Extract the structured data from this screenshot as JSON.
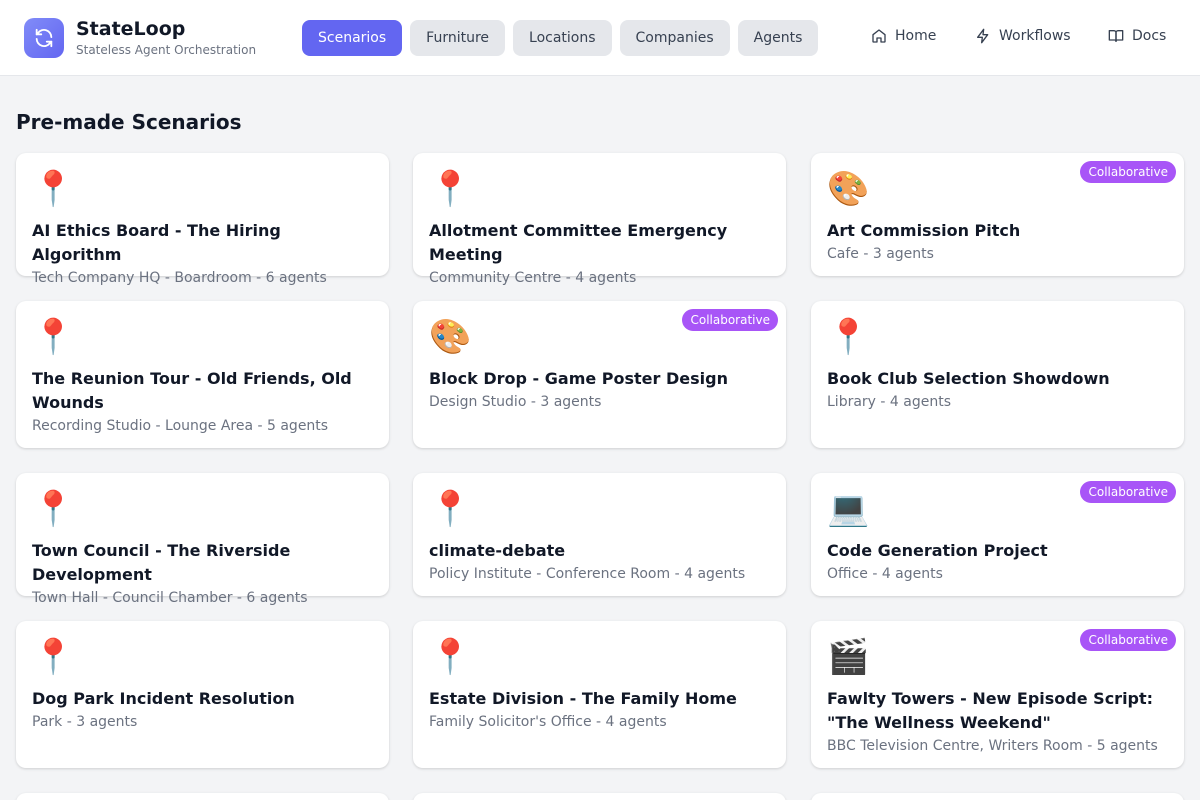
{
  "app": {
    "name": "StateLoop",
    "tagline": "Stateless Agent Orchestration"
  },
  "tabs": [
    {
      "label": "Scenarios",
      "active": true
    },
    {
      "label": "Furniture",
      "active": false
    },
    {
      "label": "Locations",
      "active": false
    },
    {
      "label": "Companies",
      "active": false
    },
    {
      "label": "Agents",
      "active": false
    }
  ],
  "right_nav": [
    {
      "label": "Home",
      "icon": "home-icon"
    },
    {
      "label": "Workflows",
      "icon": "lightning-icon"
    },
    {
      "label": "Docs",
      "icon": "book-icon"
    }
  ],
  "page": {
    "title": "Pre-made Scenarios"
  },
  "scenarios": [
    {
      "title": "AI Ethics Board - The Hiring Algorithm",
      "meta": "Tech Company HQ - Boardroom - 6 agents",
      "icon": "📍",
      "icon_name": "pin-icon",
      "badge": ""
    },
    {
      "title": "Allotment Committee Emergency Meeting",
      "meta": "Community Centre - 4 agents",
      "icon": "📍",
      "icon_name": "pin-icon",
      "badge": ""
    },
    {
      "title": "Art Commission Pitch",
      "meta": "Cafe - 3 agents",
      "icon": "🎨",
      "icon_name": "palette-icon",
      "badge": "Collaborative"
    },
    {
      "title": "The Reunion Tour - Old Friends, Old Wounds",
      "meta": "Recording Studio - Lounge Area - 5 agents",
      "icon": "📍",
      "icon_name": "pin-icon",
      "badge": ""
    },
    {
      "title": "Block Drop - Game Poster Design",
      "meta": "Design Studio - 3 agents",
      "icon": "🎨",
      "icon_name": "palette-icon",
      "badge": "Collaborative"
    },
    {
      "title": "Book Club Selection Showdown",
      "meta": "Library - 4 agents",
      "icon": "📍",
      "icon_name": "pin-icon",
      "badge": ""
    },
    {
      "title": "Town Council - The Riverside Development",
      "meta": "Town Hall - Council Chamber - 6 agents",
      "icon": "📍",
      "icon_name": "pin-icon",
      "badge": ""
    },
    {
      "title": "climate-debate",
      "meta": "Policy Institute - Conference Room - 4 agents",
      "icon": "📍",
      "icon_name": "pin-icon",
      "badge": ""
    },
    {
      "title": "Code Generation Project",
      "meta": "Office - 4 agents",
      "icon": "💻",
      "icon_name": "laptop-icon",
      "badge": "Collaborative"
    },
    {
      "title": "Dog Park Incident Resolution",
      "meta": "Park - 3 agents",
      "icon": "📍",
      "icon_name": "pin-icon",
      "badge": ""
    },
    {
      "title": "Estate Division - The Family Home",
      "meta": "Family Solicitor's Office - 4 agents",
      "icon": "📍",
      "icon_name": "pin-icon",
      "badge": ""
    },
    {
      "title": "Fawlty Towers - New Episode Script: \"The Wellness Weekend\"",
      "meta": "BBC Television Centre, Writers Room - 5 agents",
      "icon": "🎬",
      "icon_name": "clapperboard-icon",
      "badge": "Collaborative"
    }
  ],
  "colors": {
    "accent": "#6366f1",
    "badge": "#a855f7",
    "background": "#f3f4f6"
  }
}
